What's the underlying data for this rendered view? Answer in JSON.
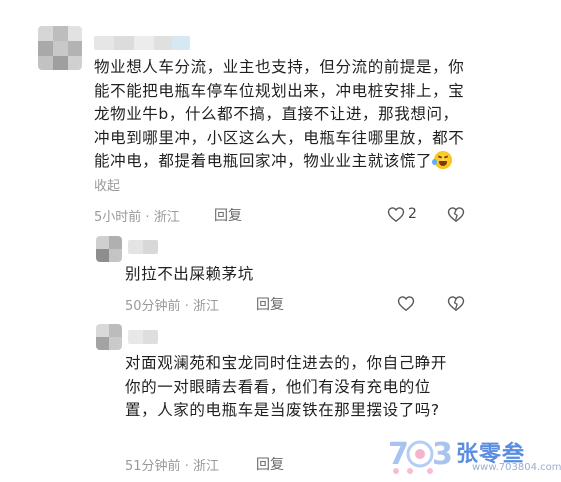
{
  "comments": [
    {
      "text": "物业想人车分流，业主也支持，但分流的前提是，你能不能把电瓶车停车位规划出来，冲电桩安排上，宝龙物业牛b，什么都不搞，直接不让进，那我想问，冲电到哪里冲，小区这么大，电瓶车往哪里放，都不能冲电，都提着电瓶回家冲，物业业主就该慌了",
      "emoji": "laughing-crying-emoji",
      "collapse_label": "收起",
      "time": "5小时前",
      "location": "浙江",
      "reply_label": "回复",
      "like_count": "2"
    },
    {
      "text": "别拉不出屎赖茅坑",
      "time": "50分钟前",
      "location": "浙江",
      "reply_label": "回复"
    },
    {
      "text": "对面观澜苑和宝龙同时住进去的，你自己睁开你的一对眼睛去看看，他们有没有充电的位置，人家的电瓶车是当废铁在那里摆设了吗?",
      "time": "51分钟前",
      "location": "浙江",
      "reply_label": "回复"
    }
  ],
  "separator": "·",
  "watermark": {
    "brand": "张零叁",
    "url": "www.703804.com"
  },
  "colors": {
    "meta": "#9a9a9a",
    "text": "#1f1f1f",
    "brand": "#5a8de0"
  }
}
